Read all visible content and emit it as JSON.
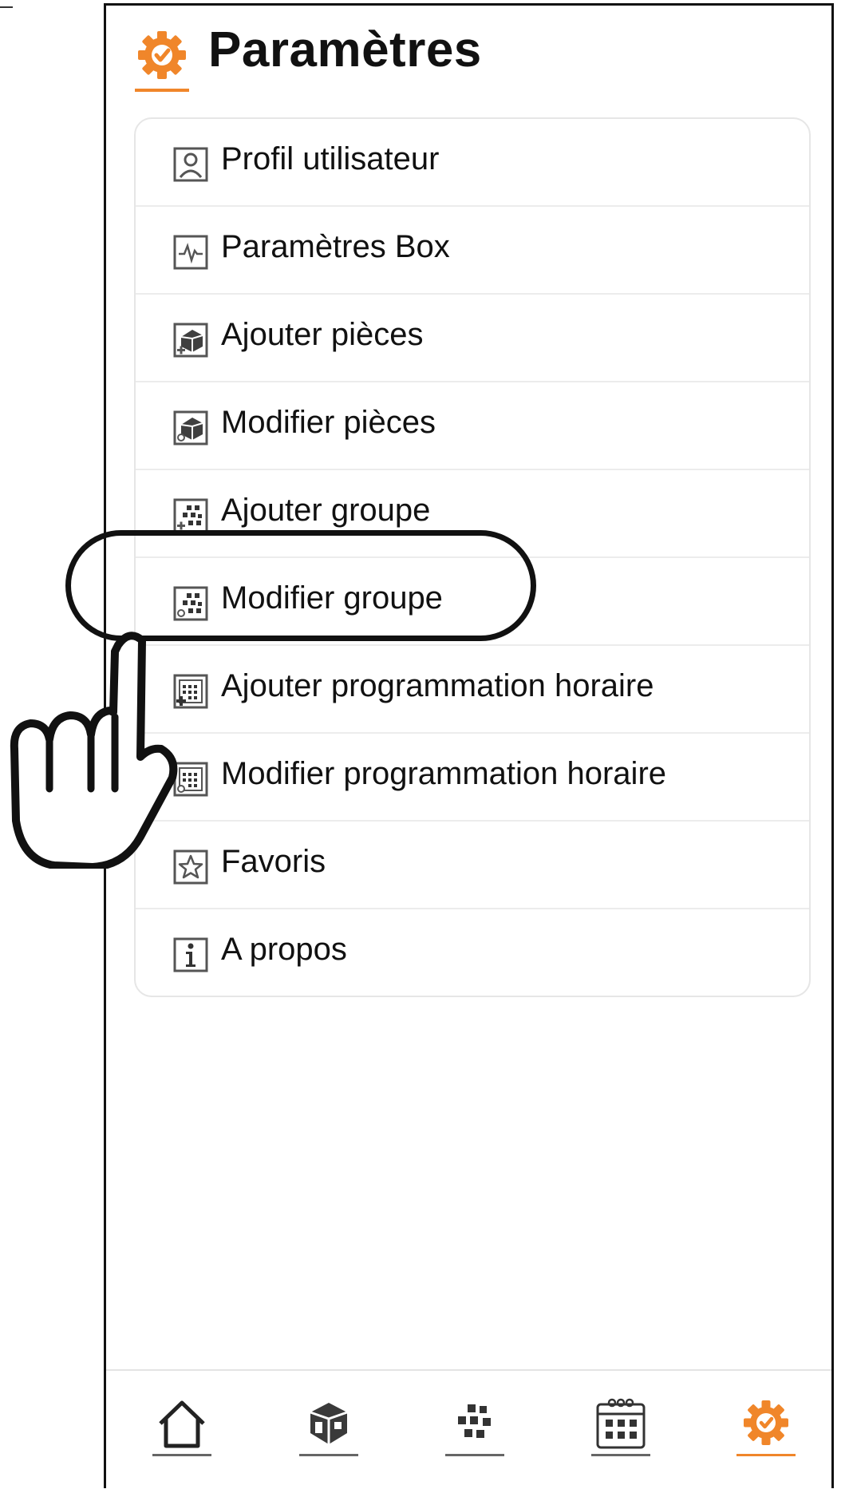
{
  "header": {
    "title": "Paramètres",
    "icon": "gear-check-icon",
    "accent_color": "#f0862a"
  },
  "menu": {
    "items": [
      {
        "label": "Profil utilisateur",
        "icon": "user-profile-icon"
      },
      {
        "label": "Paramètres Box",
        "icon": "box-pulse-icon"
      },
      {
        "label": "Ajouter pièces",
        "icon": "add-room-icon"
      },
      {
        "label": "Modifier pièces",
        "icon": "edit-room-icon"
      },
      {
        "label": "Ajouter groupe",
        "icon": "add-group-icon"
      },
      {
        "label": "Modifier groupe",
        "icon": "edit-group-icon"
      },
      {
        "label": "Ajouter programmation horaire",
        "icon": "add-schedule-icon"
      },
      {
        "label": "Modifier programmation horaire",
        "icon": "edit-schedule-icon"
      },
      {
        "label": "Favoris",
        "icon": "star-icon"
      },
      {
        "label": "A propos",
        "icon": "info-icon"
      }
    ],
    "highlighted_item": "Modifier groupe"
  },
  "bottom_nav": {
    "items": [
      {
        "icon": "home-icon"
      },
      {
        "icon": "rooms-cube-icon"
      },
      {
        "icon": "group-dots-icon"
      },
      {
        "icon": "calendar-icon"
      },
      {
        "icon": "settings-gear-icon",
        "active": true
      }
    ],
    "active_color": "#f0862a"
  }
}
